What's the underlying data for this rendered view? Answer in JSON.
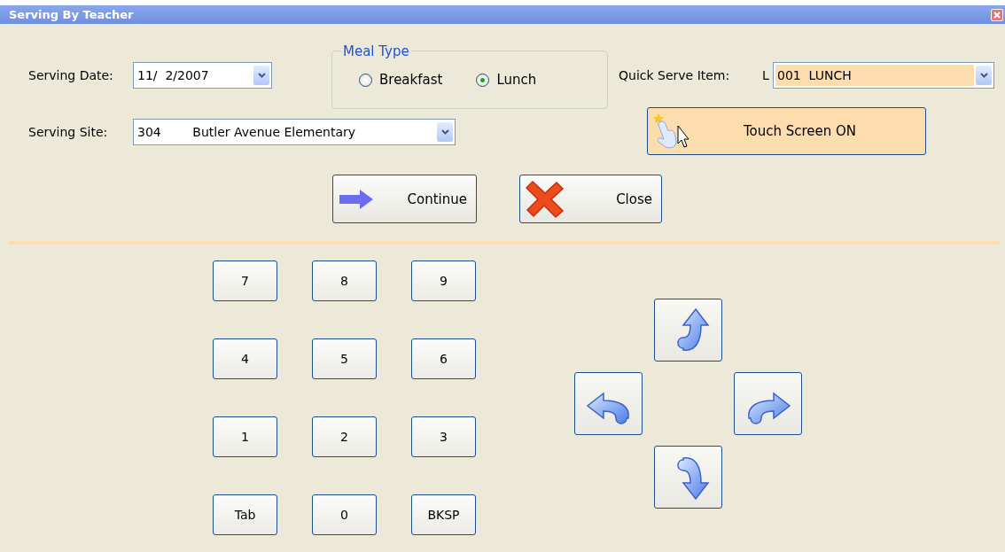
{
  "window": {
    "title": "Serving By Teacher"
  },
  "serving_date": {
    "label": "Serving Date:",
    "value": "11/  2/2007"
  },
  "meal_type": {
    "legend": "Meal Type",
    "options": [
      {
        "label": "Breakfast",
        "selected": false
      },
      {
        "label": "Lunch",
        "selected": true
      }
    ]
  },
  "quick_serve_item": {
    "label": "Quick Serve Item:",
    "prefix": "L",
    "value": "001  LUNCH"
  },
  "serving_site": {
    "label": "Serving Site:",
    "code": "304",
    "name": "Butler Avenue Elementary"
  },
  "touch_screen": {
    "label": "Touch Screen ON",
    "on": true
  },
  "buttons": [
    {
      "kind": "continue",
      "label": "Continue"
    },
    {
      "kind": "close",
      "label": "Close"
    }
  ],
  "keypad": [
    "7",
    "8",
    "9",
    "4",
    "5",
    "6",
    "1",
    "2",
    "3",
    "Tab",
    "0",
    "BKSP"
  ]
}
